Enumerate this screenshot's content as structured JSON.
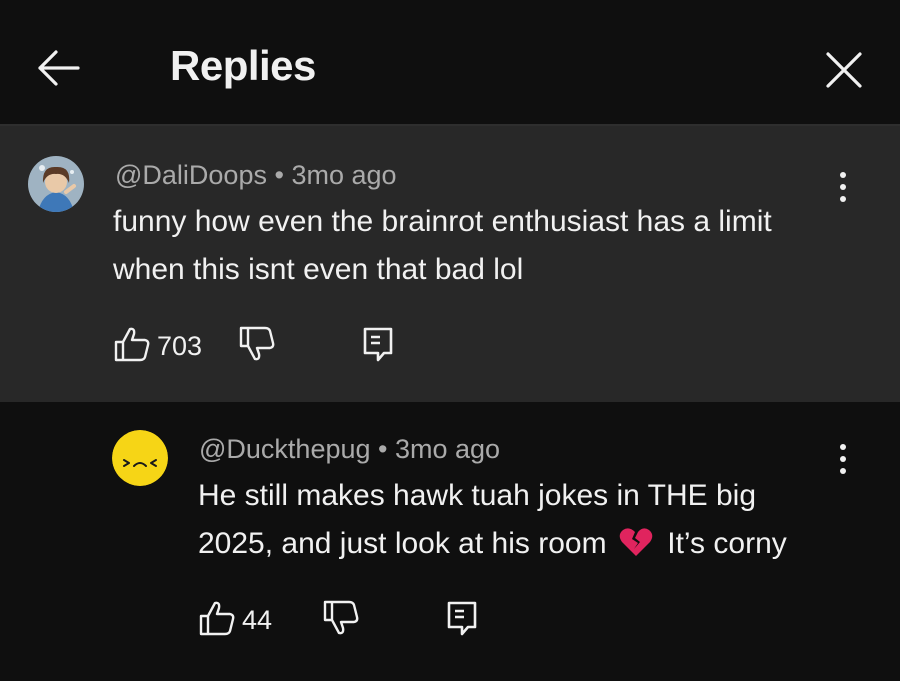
{
  "header": {
    "title": "Replies"
  },
  "parent_comment": {
    "handle": "@DaliDoops",
    "age": "3mo ago",
    "text_line1": "funny how even the brainrot enthusiast has a limit",
    "text_line2": "when this isnt even that bad lol",
    "likes": "703"
  },
  "reply_comment": {
    "handle": "@Duckthepug",
    "age": "3mo ago",
    "text_line1": "He still makes hawk tuah jokes in THE big",
    "text_line2_before": "2025, and just look at his room",
    "emoji": "💔",
    "text_line2_after": "It’s corny",
    "likes": "44"
  },
  "separator": "•",
  "icons": {
    "back": "arrow-left-icon",
    "close": "close-icon",
    "like": "thumbs-up-icon",
    "dislike": "thumbs-down-icon",
    "reply": "reply-icon",
    "more": "more-vertical-icon"
  },
  "colors": {
    "background": "#0f0f0f",
    "highlighted_comment": "#282828",
    "text": "#f1f1f1",
    "secondary_text": "#aaaaaa",
    "reply_avatar": "#f6d516"
  }
}
